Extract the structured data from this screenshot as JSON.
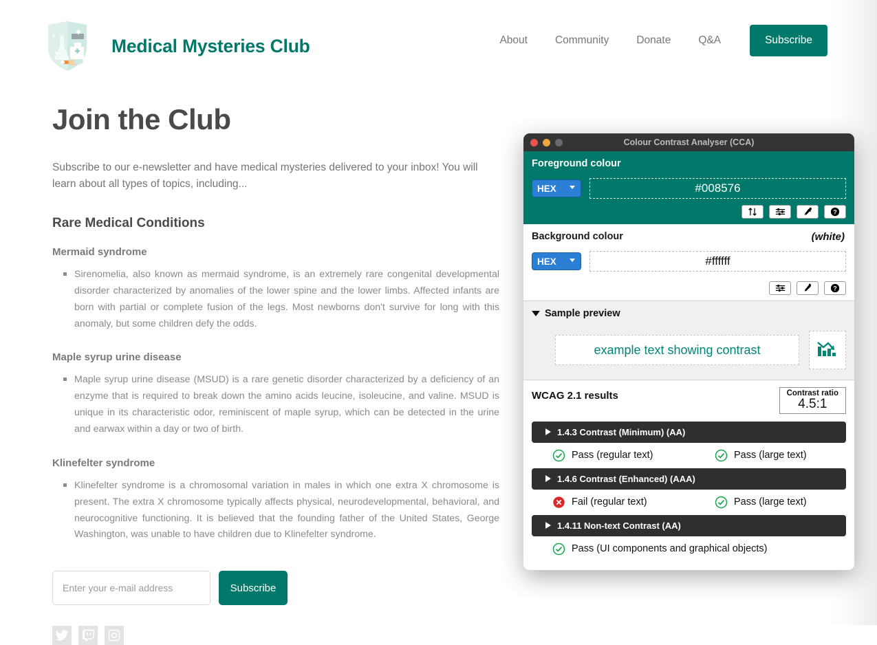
{
  "site": {
    "brand_title": "Medical Mysteries Club",
    "logo_icon": "shield-medical-logo-icon",
    "nav": [
      {
        "label": "About",
        "name": "nav-link-about"
      },
      {
        "label": "Community",
        "name": "nav-link-community"
      },
      {
        "label": "Donate",
        "name": "nav-link-donate"
      },
      {
        "label": "Q&A",
        "name": "nav-link-qa"
      }
    ],
    "nav_subscribe_label": "Subscribe",
    "accent_color": "#00796b"
  },
  "main": {
    "page_title": "Join the Club",
    "intro": "Subscribe to our e-newsletter and have medical mysteries delivered to your inbox! You will learn about all types of topics, including...",
    "section_title": "Rare Medical Conditions",
    "conditions": [
      {
        "title": "Mermaid syndrome",
        "body": "Sirenomelia, also known as mermaid syndrome, is an extremely rare congenital developmental disorder characterized by anomalies of the lower spine and the lower limbs. Affected infants are born with partial or complete fusion of the legs. Most newborns don't survive for long with this anomaly, but some children defy the odds."
      },
      {
        "title": "Maple syrup urine disease",
        "body": "Maple syrup urine disease (MSUD) is a rare genetic disorder characterized by a deficiency of an enzyme that is required to break down the amino acids leucine, isoleucine, and valine. MSUD is unique in its characteristic odor, reminiscent of maple syrup, which can be detected in the urine and earwax within a day or two of birth."
      },
      {
        "title": "Klinefelter syndrome",
        "body": "Klinefelter syndrome is a chromosomal variation in males in which one extra X chromosome is present. The extra X chromosome typically affects physical, neurodevelopmental, behavioral, and neurocognitive functioning. It is believed that the founding father of the United States, George Washington, was unable to have children due to Klinefelter syndrome."
      }
    ],
    "form": {
      "email_placeholder": "Enter your e-mail address",
      "email_value": "",
      "subscribe_label": "Subscribe"
    },
    "social": [
      {
        "name": "twitter-icon",
        "label": "Twitter"
      },
      {
        "name": "twitch-icon",
        "label": "Twitch"
      },
      {
        "name": "instagram-icon",
        "label": "Instagram"
      }
    ]
  },
  "cca": {
    "window_title": "Colour Contrast Analyser (CCA)",
    "traffic_lights": [
      "close",
      "minimise",
      "maximise"
    ],
    "foreground": {
      "label": "Foreground colour",
      "format": "HEX",
      "value": "#008576",
      "buttons": [
        {
          "name": "swap-colours-button",
          "icon": "arrows-up-down-icon"
        },
        {
          "name": "colour-sliders-button",
          "icon": "sliders-icon"
        },
        {
          "name": "eyedropper-button",
          "icon": "eyedropper-icon"
        },
        {
          "name": "help-button",
          "icon": "question-circle-icon"
        }
      ]
    },
    "background": {
      "label": "Background colour",
      "note": "(white)",
      "format": "HEX",
      "value": "#ffffff",
      "buttons": [
        {
          "name": "colour-sliders-button",
          "icon": "sliders-icon"
        },
        {
          "name": "eyedropper-button",
          "icon": "eyedropper-icon"
        },
        {
          "name": "help-button",
          "icon": "question-circle-icon"
        }
      ]
    },
    "preview": {
      "title": "Sample preview",
      "sample_text": "example text showing contrast",
      "graphic_icon": "bar-chart-declining-icon"
    },
    "results": {
      "title": "WCAG 2.1 results",
      "contrast_label": "Contrast ratio",
      "contrast_value": "4.5:1",
      "groups": [
        {
          "name": "wcag-143",
          "label": "1.4.3 Contrast (Minimum) (AA)",
          "items": [
            {
              "status": "pass",
              "label": "Pass (regular text)"
            },
            {
              "status": "pass",
              "label": "Pass (large text)"
            }
          ]
        },
        {
          "name": "wcag-146",
          "label": "1.4.6 Contrast (Enhanced) (AAA)",
          "items": [
            {
              "status": "fail",
              "label": "Fail (regular text)"
            },
            {
              "status": "pass",
              "label": "Pass (large text)"
            }
          ]
        },
        {
          "name": "wcag-1411",
          "label": "1.4.11 Non-text Contrast (AA)",
          "items": [
            {
              "status": "pass",
              "label": "Pass (UI components and graphical objects)"
            }
          ]
        }
      ]
    }
  }
}
